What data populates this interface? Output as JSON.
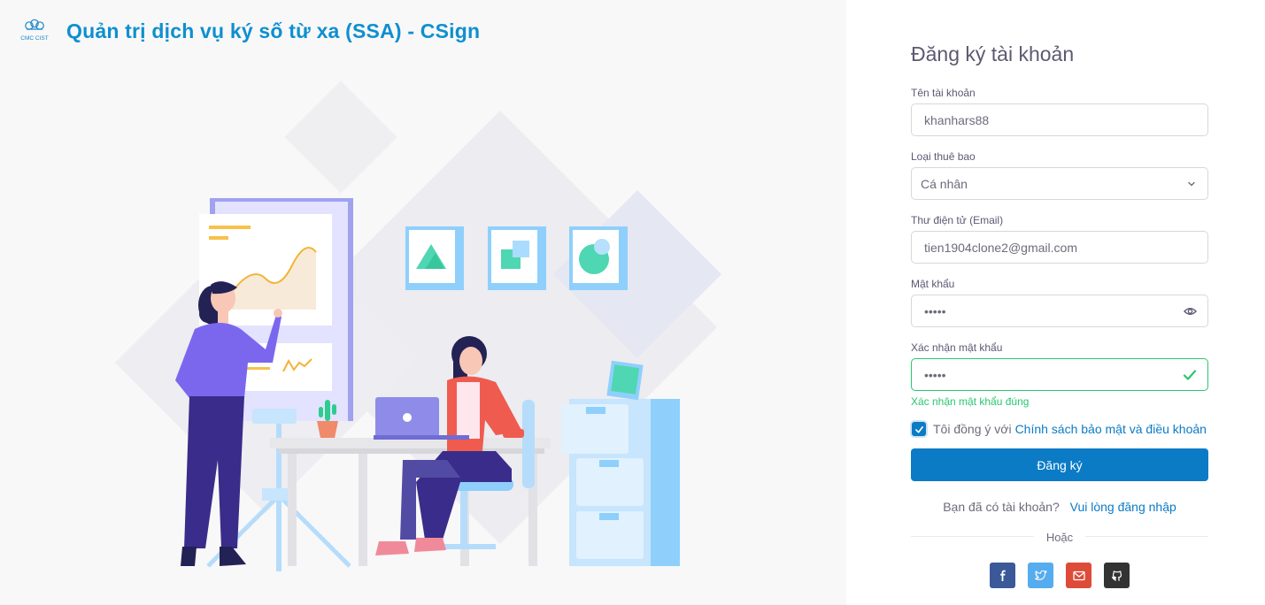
{
  "brand": {
    "logo_text": "CMC CIST",
    "title": "Quản trị dịch vụ ký số từ xa (SSA) - CSign"
  },
  "form": {
    "title": "Đăng ký tài khoản",
    "username": {
      "label": "Tên tài khoản",
      "value": "khanhars88"
    },
    "subscription": {
      "label": "Loại thuê bao",
      "value": "Cá nhân",
      "icon": "chevron-down-icon"
    },
    "email": {
      "label": "Thư điện tử (Email)",
      "value": "tien1904clone2@gmail.com"
    },
    "password": {
      "label": "Mật khẩu",
      "value": "•••••",
      "icon": "eye-icon"
    },
    "confirm_password": {
      "label": "Xác nhận mật khẩu",
      "value": "•••••",
      "icon": "check-icon",
      "valid_message": "Xác nhận mật khẩu đúng"
    },
    "agree": {
      "checked": true,
      "text": "Tôi đồng ý với",
      "link": "Chính sách bảo mật và điều khoản"
    },
    "submit_label": "Đăng ký",
    "login_prompt": {
      "text": "Bạn đã có tài khoản?",
      "link": "Vui lòng đăng nhập"
    },
    "divider_text": "Hoặc",
    "socials": [
      {
        "name": "facebook",
        "icon": "facebook-icon",
        "color": "#3b5998"
      },
      {
        "name": "twitter",
        "icon": "twitter-icon",
        "color": "#55acee"
      },
      {
        "name": "google",
        "icon": "mail-icon",
        "color": "#dd4b39"
      },
      {
        "name": "github",
        "icon": "github-icon",
        "color": "#333333"
      }
    ]
  },
  "colors": {
    "brand": "#0e8fd0",
    "primary": "#0b7bc6",
    "success": "#28c76f",
    "text": "#5e5873"
  }
}
